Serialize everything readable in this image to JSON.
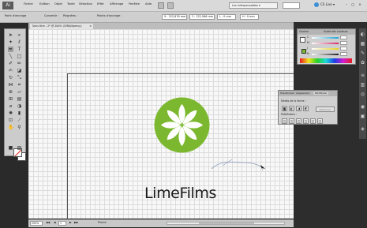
{
  "app": {
    "logo": "Ai"
  },
  "menubar": {
    "items": [
      "Fichier",
      "Edition",
      "Objet",
      "Texte",
      "Sélection",
      "Effet",
      "Affichage",
      "Fenêtre",
      "Aide"
    ],
    "workspace": "Les indispensables ▾",
    "cs_live": "CS Live ▾",
    "window_buttons": "– □ ×"
  },
  "controlbar": {
    "label": "Point d'ancrage",
    "convert": "Convertir :",
    "handles": "Poignées :",
    "anchors": "Points d'ancrage :",
    "x": "X : 222,876 mm",
    "y": "Y : 122,566 mm",
    "w": "L : 0 mm",
    "h": "H : 0 mm"
  },
  "document": {
    "tab_label": "Sans titre - 2* @ 200% (CMJN/Aperçu)",
    "tab_close": "×"
  },
  "artwork": {
    "logo_color": "#7cb82f",
    "wordmark": "LimeFilms"
  },
  "color_panel": {
    "tabs": [
      "Couleur",
      "Guide des couleurs"
    ],
    "channels": [
      "C",
      "M",
      "J",
      "N"
    ],
    "slider_colors": [
      "#1fa7d9",
      "#d8266d",
      "#e8d21f",
      "#222222"
    ]
  },
  "pathfinder_panel": {
    "tabs": [
      "Transformer",
      "Alignement",
      "Pathfinder"
    ],
    "shape_modes_label": "Modes de la forme :",
    "pathfinders_label": "Pathfinders :",
    "apply_button": "Extension"
  },
  "statusbar": {
    "zoom": "200%",
    "page": "1",
    "tool": "Plume"
  }
}
